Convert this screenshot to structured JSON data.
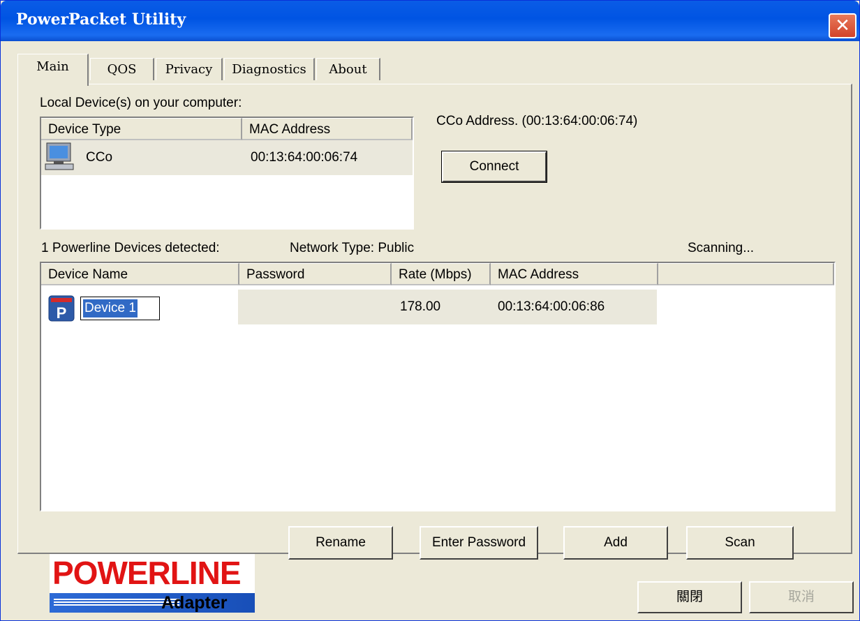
{
  "window": {
    "title": "PowerPacket Utility"
  },
  "tabs": [
    {
      "label": "Main",
      "active": true
    },
    {
      "label": "QOS"
    },
    {
      "label": "Privacy"
    },
    {
      "label": "Diagnostics"
    },
    {
      "label": "About"
    }
  ],
  "local": {
    "label": "Local Device(s) on your computer:",
    "columns": [
      "Device Type",
      "MAC Address"
    ],
    "rows": [
      {
        "type": "CCo",
        "mac": "00:13:64:00:06:74",
        "icon": "computer-icon"
      }
    ],
    "cco_address": "CCo Address. (00:13:64:00:06:74)",
    "connect_label": "Connect"
  },
  "powerline": {
    "detected_label": "1 Powerline Devices detected:",
    "network_type": "Network Type: Public",
    "status": "Scanning...",
    "columns": [
      "Device Name",
      "Password",
      "Rate (Mbps)",
      "MAC Address"
    ],
    "rows": [
      {
        "name": "Device 1",
        "password": "",
        "rate": "178.00",
        "mac": "00:13:64:00:06:86",
        "icon": "powerpacket-icon"
      }
    ]
  },
  "logo": {
    "word": "POWERLINE",
    "sub": "Adapter"
  },
  "buttons": {
    "rename": "Rename",
    "enter_password": "Enter Password",
    "add": "Add",
    "scan": "Scan"
  },
  "footer": {
    "close": "關閉",
    "cancel": "取消"
  },
  "colors": {
    "title_bar": "#0054e3",
    "selection": "#316ac5",
    "logo_red": "#e11414",
    "logo_blue": "#2d6ad6"
  }
}
